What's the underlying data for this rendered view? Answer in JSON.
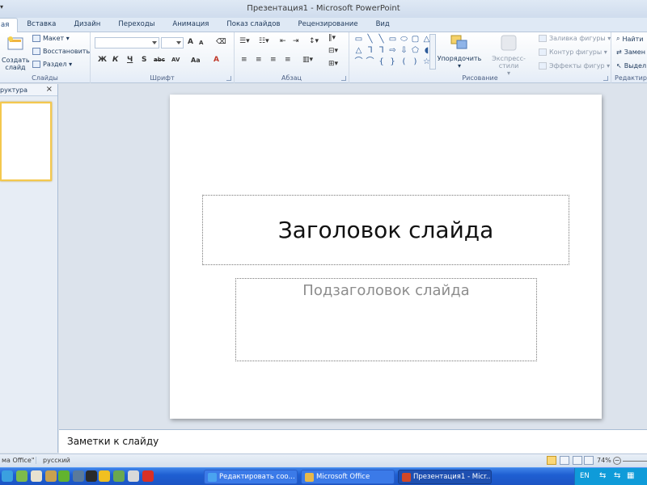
{
  "window": {
    "title": "Презентация1  -  Microsoft PowerPoint"
  },
  "tabs": [
    "Главная",
    "Вставка",
    "Дизайн",
    "Переходы",
    "Анимация",
    "Показ слайдов",
    "Рецензирование",
    "Вид"
  ],
  "tabs_visible": [
    "ая",
    "Вставка",
    "Дизайн",
    "Переходы",
    "Анимация",
    "Показ слайдов",
    "Рецензирование",
    "Вид"
  ],
  "ribbon": {
    "slides": {
      "label": "Слайды",
      "create": "Создать\nслайд",
      "layout": "Макет",
      "reset": "Восстановить",
      "section": "Раздел"
    },
    "font": {
      "label": "Шрифт",
      "bold": "Ж",
      "italic": "К",
      "underline": "Ч",
      "shadow": "S",
      "strike": "abc",
      "spacing": "AV",
      "case": "Aa",
      "grow": "A",
      "shrink": "A",
      "color": "A"
    },
    "paragraph": {
      "label": "Абзац"
    },
    "drawing": {
      "label": "Рисование",
      "arrange": "Упорядочить",
      "quick_styles": "Экспресс-стили",
      "fill": "Заливка фигуры",
      "outline": "Контур фигуры",
      "effects": "Эффекты фигур"
    },
    "editing": {
      "label": "Редактиров",
      "find": "Найти",
      "replace": "Замен",
      "select": "Выдел"
    }
  },
  "left_panel": {
    "tab_label": "руктура",
    "close": "×"
  },
  "slide": {
    "title_placeholder": "Заголовок слайда",
    "subtitle_placeholder": "Подзаголовок слайда"
  },
  "notes": {
    "placeholder": "Заметки к слайду"
  },
  "status": {
    "theme": "ма Office\"",
    "language": "русский",
    "zoom": "74%"
  },
  "taskbar": {
    "tasks": [
      {
        "label": "Редактировать соо..."
      },
      {
        "label": "Microsoft Office"
      },
      {
        "label": "Презентация1 - Micr..."
      }
    ],
    "lang": "EN"
  },
  "colors": {
    "accent": "#2a4f7f",
    "taskbar": "#1f5fd2",
    "thumb_border": "#f4c84e"
  }
}
